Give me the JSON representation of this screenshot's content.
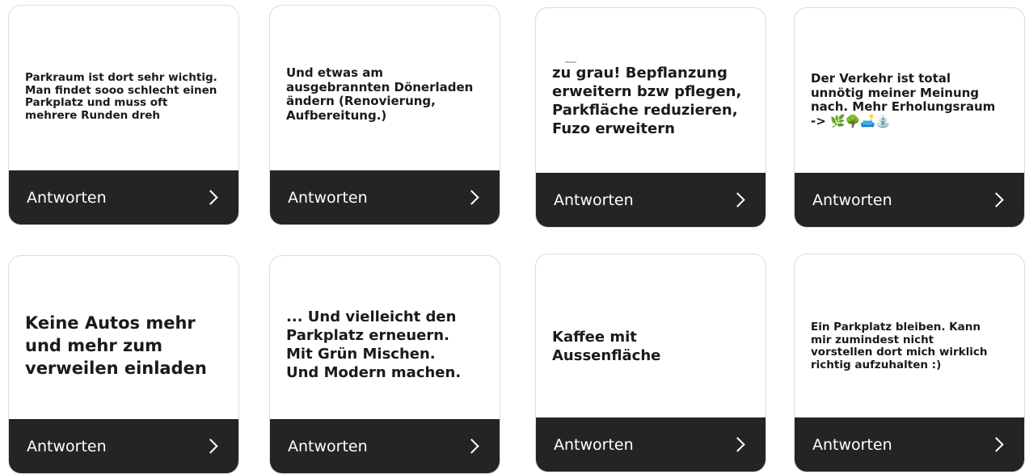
{
  "cards": [
    {
      "text": "Parkraum ist dort sehr wichtig.\nMan findet sooo schlecht einen\nParkplatz und muss oft\nmehrere Runden dreh",
      "button_label": "Antworten"
    },
    {
      "text": "Und etwas am\nausgebrannten Dönerladen\nändern (Renovierung,\nAufbereitung.)",
      "button_label": "Antworten"
    },
    {
      "text": "zu grau! Bepflanzung\nerweitern bzw pflegen,\nParkfläche reduzieren,\nFuzo erweitern",
      "button_label": "Antworten"
    },
    {
      "text": "Der Verkehr ist total\nunnötig meiner Meinung\nnach. Mehr Erholungsraum\n-> 🌿🌳🛋️⛲",
      "button_label": "Antworten"
    },
    {
      "text": "Keine Autos mehr\nund mehr zum\nverweilen einladen",
      "button_label": "Antworten"
    },
    {
      "text": "... Und vielleicht den\nParkplatz erneuern.\nMit Grün Mischen.\nUnd Modern machen.",
      "button_label": "Antworten"
    },
    {
      "text": "Kaffee mit\nAussenfläche",
      "button_label": "Antworten"
    },
    {
      "text": "Ein Parkplatz bleiben. Kann\nmir zumindest nicht\nvorstellen dort mich wirklich\nrichtig aufzuhalten :)",
      "button_label": "Antworten"
    }
  ],
  "icons": {
    "chevron": "chevron-right-icon"
  },
  "colors": {
    "footer_bg": "#242424",
    "footer_text": "#ffffff",
    "card_text": "#1a1a1a"
  }
}
